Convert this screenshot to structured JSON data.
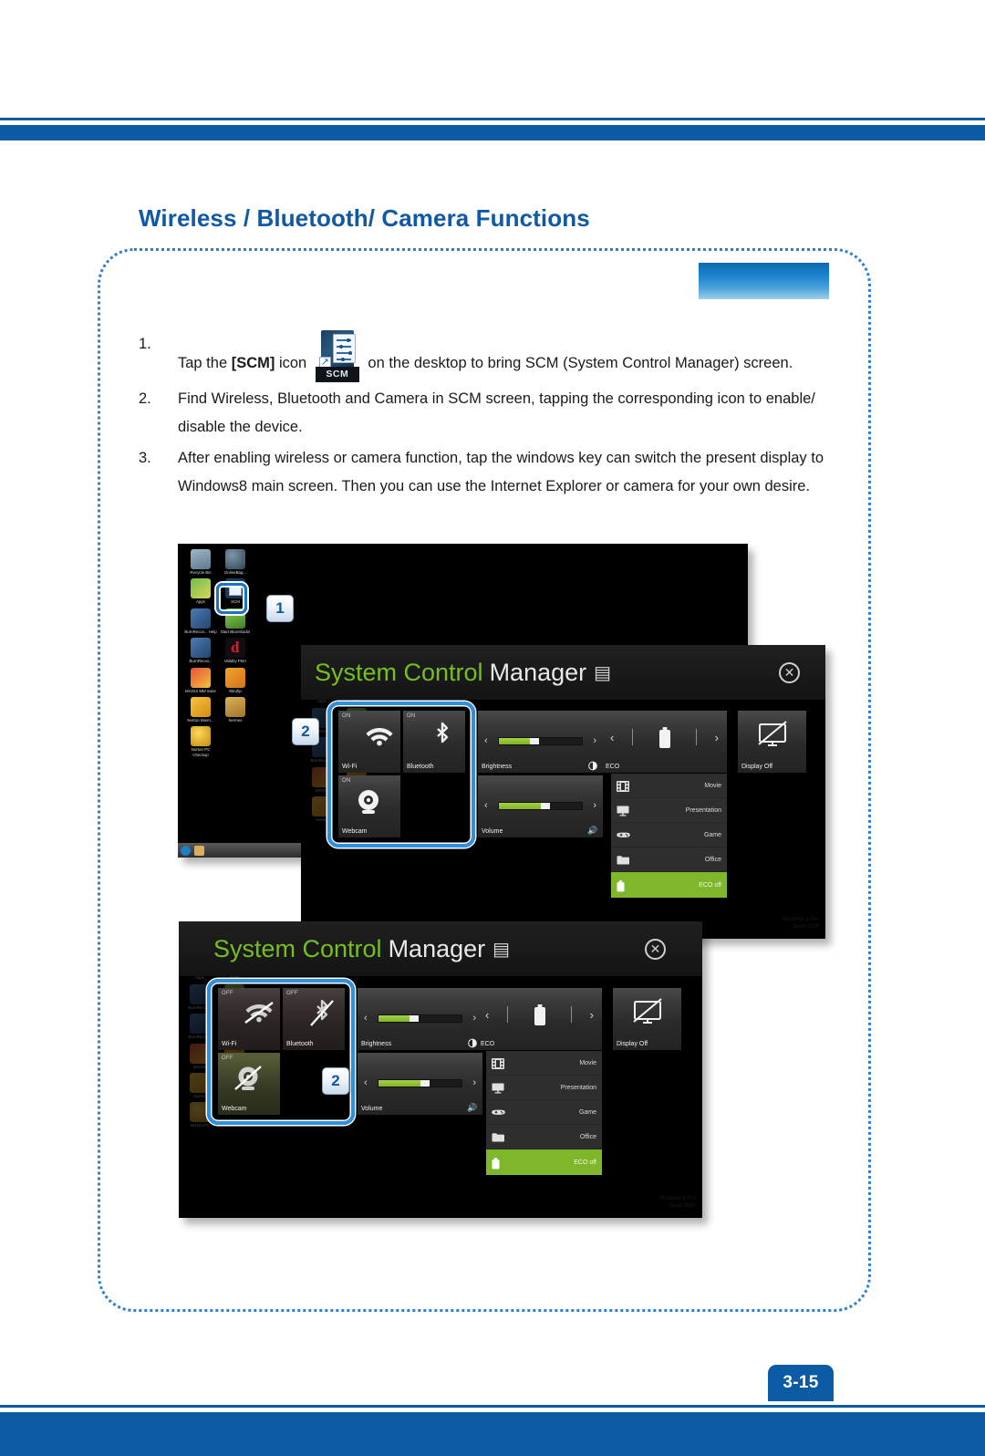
{
  "page": {
    "heading_part1": "Wireless / Bluetooth",
    "heading_part2": "/ Camera Functions",
    "heading_full": "Wireless / Bluetooth/ Camera Functions",
    "page_number": "3-15",
    "accent_color": "#0b5ba4",
    "heading_color": "#1059a4",
    "dotted_border_color": "#2f7fd0"
  },
  "steps": [
    {
      "num": "1.",
      "text_before": "Tap the ",
      "bold": "[SCM]",
      "text_mid": " icon ",
      "text_after": " on the desktop to bring SCM (System Control Manager) screen.",
      "icon_label": "SCM"
    },
    {
      "num": "2.",
      "text_before": "",
      "bold": "",
      "text_mid": "",
      "text_after": "Find Wireless, Bluetooth and Camera in SCM screen, tapping the corresponding icon to enable/ disable the device.",
      "icon_label": ""
    },
    {
      "num": "3.",
      "text_before": "",
      "bold": "",
      "text_mid": "",
      "text_after": "After enabling wireless or camera function, tap the windows key can switch the present display to Windows8 main screen. Then you can use the Internet Explorer or camera for your own desire.",
      "icon_label": ""
    }
  ],
  "callouts": {
    "one": "1",
    "two": "2"
  },
  "desktop": {
    "icons": [
      {
        "label": "Recycle Bin",
        "icon": "recycle-bin-icon"
      },
      {
        "label": "OnlineBag...",
        "icon": "mozy-online-backup-icon"
      },
      {
        "label": "Apps",
        "icon": "apps-icon"
      },
      {
        "label": "SCM",
        "icon": "scm-icon"
      },
      {
        "label": "BurnRecov... Help",
        "icon": "burn-recovery-help-icon"
      },
      {
        "label": "Start BlueStacks",
        "icon": "bluestacks-icon"
      },
      {
        "label": "BurnRecov...",
        "icon": "burn-recovery-icon"
      },
      {
        "label": "Validity FMA",
        "icon": "validity-fma-icon"
      },
      {
        "label": "MAGIX MM Suite",
        "icon": "magix-mm-suite-icon"
      },
      {
        "label": "WinZip",
        "icon": "winzip-icon"
      },
      {
        "label": "Norton Intern...",
        "icon": "norton-internet-security-icon"
      },
      {
        "label": "hermes",
        "icon": "folder-icon"
      },
      {
        "label": "Norton PC Checkup",
        "icon": "norton-pc-checkup-icon"
      }
    ]
  },
  "scm_window": {
    "title_green": "System Control",
    "title_white": "Manager",
    "title_icon": "scm-title-icon",
    "close_icon": "close-icon",
    "watermark_line1": "Windows 8 Pro",
    "watermark_line2": "Build 9200"
  },
  "scm_on": {
    "tiles": [
      {
        "name": "Wi-Fi",
        "state": "ON",
        "icon": "wifi-icon"
      },
      {
        "name": "Bluetooth",
        "state": "ON",
        "icon": "bluetooth-icon"
      },
      {
        "name": "Webcam",
        "state": "ON",
        "icon": "webcam-icon"
      }
    ],
    "brightness": {
      "label": "Brightness",
      "value": 38,
      "icon": "brightness-icon"
    },
    "volume": {
      "label": "Volume",
      "value": 52,
      "icon": "volume-icon"
    },
    "eco": {
      "label": "ECO",
      "icon": "battery-icon",
      "items": [
        {
          "label": "Movie",
          "icon": "film-icon",
          "active": false
        },
        {
          "label": "Presentation",
          "icon": "presentation-icon",
          "active": false
        },
        {
          "label": "Game",
          "icon": "gamepad-icon",
          "active": false
        },
        {
          "label": "Office",
          "icon": "folder-icon",
          "active": false
        },
        {
          "label": "ECO off",
          "icon": "battery-icon",
          "active": true
        }
      ]
    },
    "display_off": {
      "label": "Display Off",
      "icon": "monitor-off-icon"
    }
  },
  "scm_off": {
    "tiles": [
      {
        "name": "Wi-Fi",
        "state": "OFF",
        "icon": "wifi-off-icon"
      },
      {
        "name": "Bluetooth",
        "state": "OFF",
        "icon": "bluetooth-off-icon"
      },
      {
        "name": "Webcam",
        "state": "OFF",
        "icon": "webcam-off-icon"
      }
    ],
    "brightness": {
      "label": "Brightness",
      "value": 38,
      "icon": "brightness-icon"
    },
    "volume": {
      "label": "Volume",
      "value": 52,
      "icon": "volume-icon"
    },
    "eco": {
      "label": "ECO",
      "icon": "battery-icon",
      "items": [
        {
          "label": "Movie",
          "icon": "film-icon",
          "active": false
        },
        {
          "label": "Presentation",
          "icon": "presentation-icon",
          "active": false
        },
        {
          "label": "Game",
          "icon": "gamepad-icon",
          "active": false
        },
        {
          "label": "Office",
          "icon": "folder-icon",
          "active": false
        },
        {
          "label": "ECO off",
          "icon": "battery-icon",
          "active": true
        }
      ]
    },
    "display_off": {
      "label": "Display Off",
      "icon": "monitor-off-icon"
    }
  }
}
